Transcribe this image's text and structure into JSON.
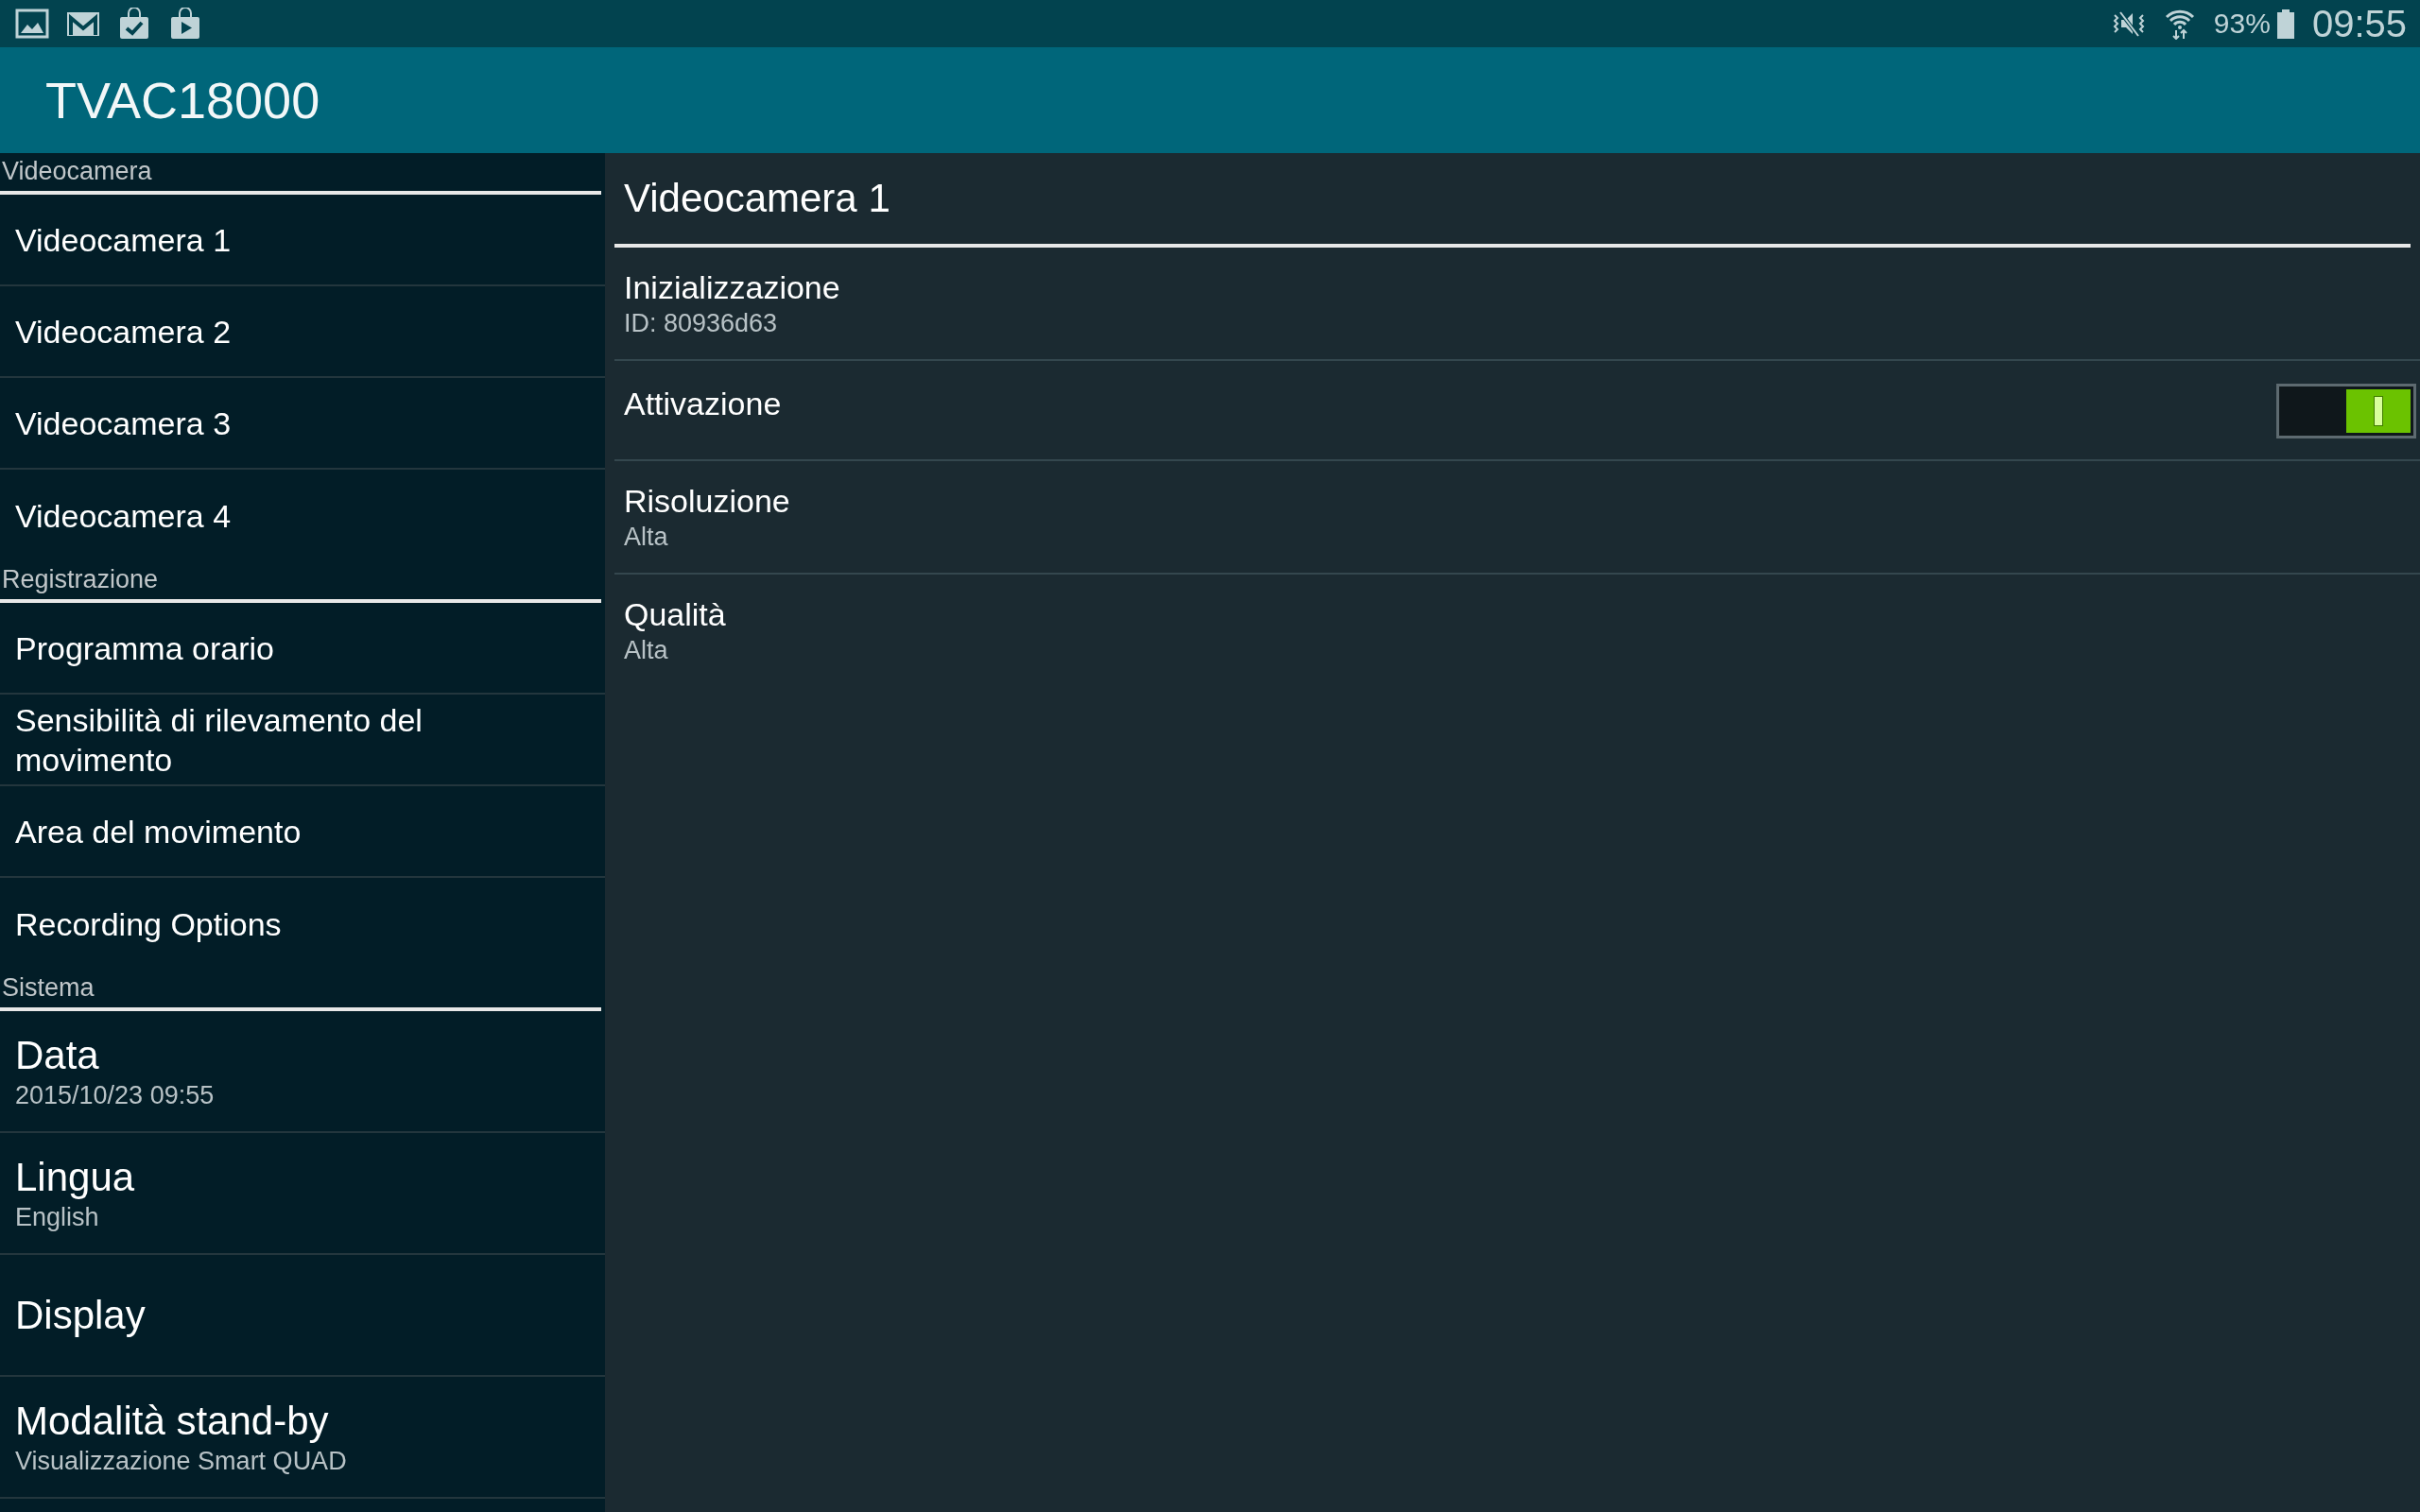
{
  "status_bar": {
    "battery_text": "93%",
    "time": "09:55"
  },
  "app_bar": {
    "title": "TVAC18000"
  },
  "sidebar": {
    "sections": [
      {
        "title": "Videocamera",
        "items": [
          {
            "kind": "small",
            "label": "Videocamera 1"
          },
          {
            "kind": "small",
            "label": "Videocamera 2"
          },
          {
            "kind": "small",
            "label": "Videocamera 3"
          },
          {
            "kind": "small",
            "label": "Videocamera 4"
          }
        ]
      },
      {
        "title": "Registrazione",
        "items": [
          {
            "kind": "small",
            "label": "Programma orario"
          },
          {
            "kind": "small",
            "label": "Sensibilità di rilevamento del movimento"
          },
          {
            "kind": "small",
            "label": "Area del movimento"
          },
          {
            "kind": "small",
            "label": "Recording Options"
          }
        ]
      },
      {
        "title": "Sistema",
        "items": [
          {
            "kind": "large",
            "label": "Data",
            "summary": "2015/10/23 09:55"
          },
          {
            "kind": "large",
            "label": "Lingua",
            "summary": "English"
          },
          {
            "kind": "large",
            "label": "Display"
          },
          {
            "kind": "large",
            "label": "Modalità stand-by",
            "summary": "Visualizzazione Smart QUAD"
          }
        ]
      }
    ]
  },
  "detail": {
    "title": "Videocamera 1",
    "rows": [
      {
        "kind": "text",
        "title": "Inizializzazione",
        "summary": "ID: 80936d63"
      },
      {
        "kind": "switch",
        "title": "Attivazione",
        "on": true
      },
      {
        "kind": "text",
        "title": "Risoluzione",
        "summary": "Alta"
      },
      {
        "kind": "text",
        "title": "Qualità",
        "summary": "Alta"
      }
    ]
  }
}
